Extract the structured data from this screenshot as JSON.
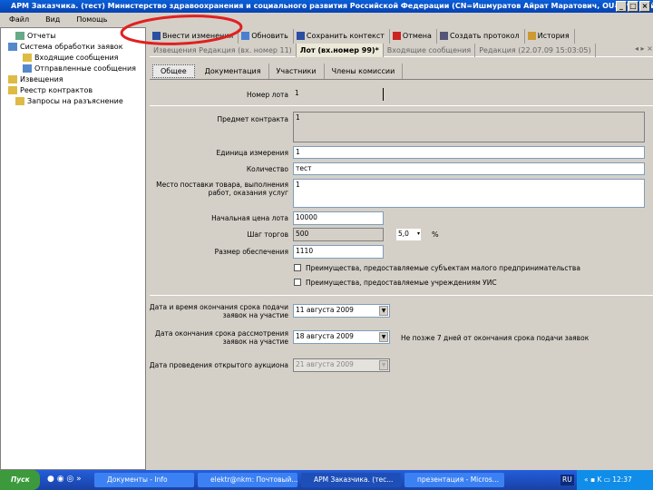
{
  "window": {
    "title": "АРМ Заказчика. (тест) Министерство здравоохранения и социального развития Российской Федерации (CN=Ишмуратов Айрат Маратович, OU=главный специал...",
    "min": "_",
    "max": "□",
    "close": "×"
  },
  "menu": [
    "Файл",
    "Вид",
    "Помощь"
  ],
  "tree": [
    {
      "label": "Отчеты",
      "indent": 1
    },
    {
      "label": "Система обработки заявок",
      "indent": 0
    },
    {
      "label": "Входящие сообщения",
      "indent": 2
    },
    {
      "label": "Отправленные сообщения",
      "indent": 2
    },
    {
      "label": "Извещения",
      "indent": 0
    },
    {
      "label": "Реестр контрактов",
      "indent": 0
    },
    {
      "label": "Запросы на разъяснение",
      "indent": 1
    }
  ],
  "toolbar": [
    "Внести изменения",
    "Обновить",
    "Сохранить контекст",
    "Отмена",
    "Создать протокол",
    "История"
  ],
  "doctabs": [
    {
      "label": "Извещения Редакция (вх. номер 11)",
      "active": false
    },
    {
      "label": "Лот (вх.номер 99)*",
      "active": true
    },
    {
      "label": "Входящие сообщения",
      "active": false
    },
    {
      "label": "Редакция (22.07.09 15:03:05)",
      "active": false
    }
  ],
  "subtabs": [
    "Общее",
    "Документация",
    "Участники",
    "Члены комиссии"
  ],
  "form": {
    "lot_number": {
      "label": "Номер лота",
      "value": "1"
    },
    "subject": {
      "label": "Предмет контракта",
      "value": "1"
    },
    "unit": {
      "label": "Единица измерения",
      "value": "1"
    },
    "quantity": {
      "label": "Количество",
      "value": "тест"
    },
    "place": {
      "label": "Место поставки товара, выполнения работ, оказания услуг",
      "value": "1"
    },
    "price": {
      "label": "Начальная цена лота",
      "value": "10000"
    },
    "step": {
      "label": "Шаг торгов",
      "value": "500",
      "percent": "5,0",
      "unit": "%"
    },
    "security": {
      "label": "Размер обеспечения",
      "value": "1110"
    },
    "check1": {
      "label": "Преимущества, предоставляемые субъектам малого предпринимательства",
      "checked": false
    },
    "check2": {
      "label": "Преимущества, предоставляемые учреждениям УИС",
      "checked": false
    },
    "date_end": {
      "label": "Дата и время окончания срока подачи заявок на участие",
      "value": "11 августа 2009"
    },
    "date_review": {
      "label": "Дата окончания срока рассмотрения заявок на участие",
      "value": "18 августа 2009",
      "note": "Не позже 7 дней от окончания срока подачи заявок"
    },
    "date_auction": {
      "label": "Дата проведения открытого аукциона",
      "value": "21 августа 2009"
    }
  },
  "taskbar": {
    "start": "Пуск",
    "tasks": [
      "Документы - Info",
      "elektr@nkm: Почтовый...",
      "АРМ Заказчика. (тес...",
      "презентация - Micros..."
    ],
    "lang": "RU",
    "clock": "12:37"
  },
  "colors": {
    "annotation": "#e02020",
    "titlebar": "#0a5fd8"
  }
}
